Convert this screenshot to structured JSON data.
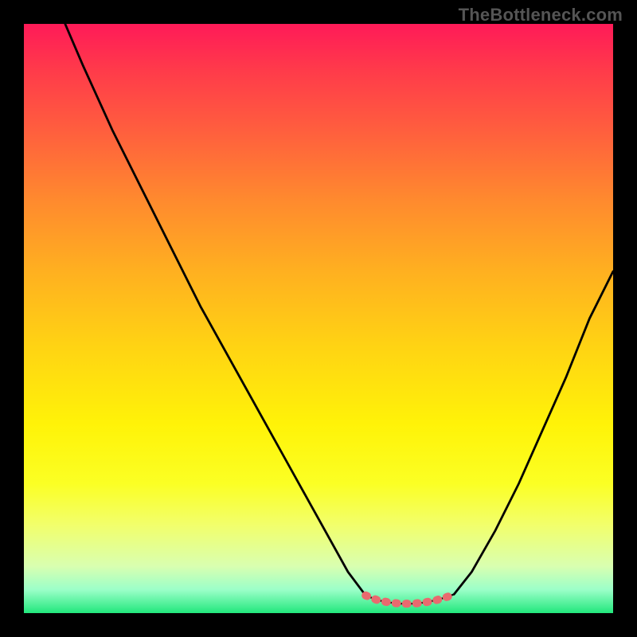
{
  "watermark": "TheBottleneck.com",
  "colors": {
    "frame": "#000000",
    "curve_main": "#000000",
    "bottom_marker": "#E96A6F",
    "gradient_top": "#ff1a58",
    "gradient_bottom": "#22e77c"
  },
  "icons": {},
  "chart_data": {
    "type": "line",
    "title": "",
    "xlabel": "",
    "ylabel": "",
    "xlim": [
      0,
      100
    ],
    "ylim": [
      0,
      100
    ],
    "grid": false,
    "legend": false,
    "series": [
      {
        "name": "left-branch",
        "x": [
          7,
          10,
          15,
          20,
          25,
          30,
          35,
          40,
          45,
          50,
          55,
          58
        ],
        "values": [
          100,
          93,
          82,
          72,
          62,
          52,
          43,
          34,
          25,
          16,
          7,
          3
        ]
      },
      {
        "name": "bottom-segment",
        "x": [
          58,
          60,
          62,
          64,
          66,
          68,
          70,
          72,
          73
        ],
        "values": [
          3,
          2.2,
          1.8,
          1.6,
          1.6,
          1.8,
          2.2,
          2.8,
          3.2
        ]
      },
      {
        "name": "right-branch",
        "x": [
          73,
          76,
          80,
          84,
          88,
          92,
          96,
          100
        ],
        "values": [
          3.2,
          7,
          14,
          22,
          31,
          40,
          50,
          58
        ]
      }
    ],
    "markers": [
      {
        "name": "bottom-dotted-marker",
        "x": [
          58,
          60,
          62,
          64,
          66,
          68,
          70,
          72,
          73
        ],
        "values": [
          3,
          2.2,
          1.8,
          1.6,
          1.6,
          1.8,
          2.2,
          2.8,
          3.2
        ],
        "color": "#E96A6F"
      }
    ]
  }
}
